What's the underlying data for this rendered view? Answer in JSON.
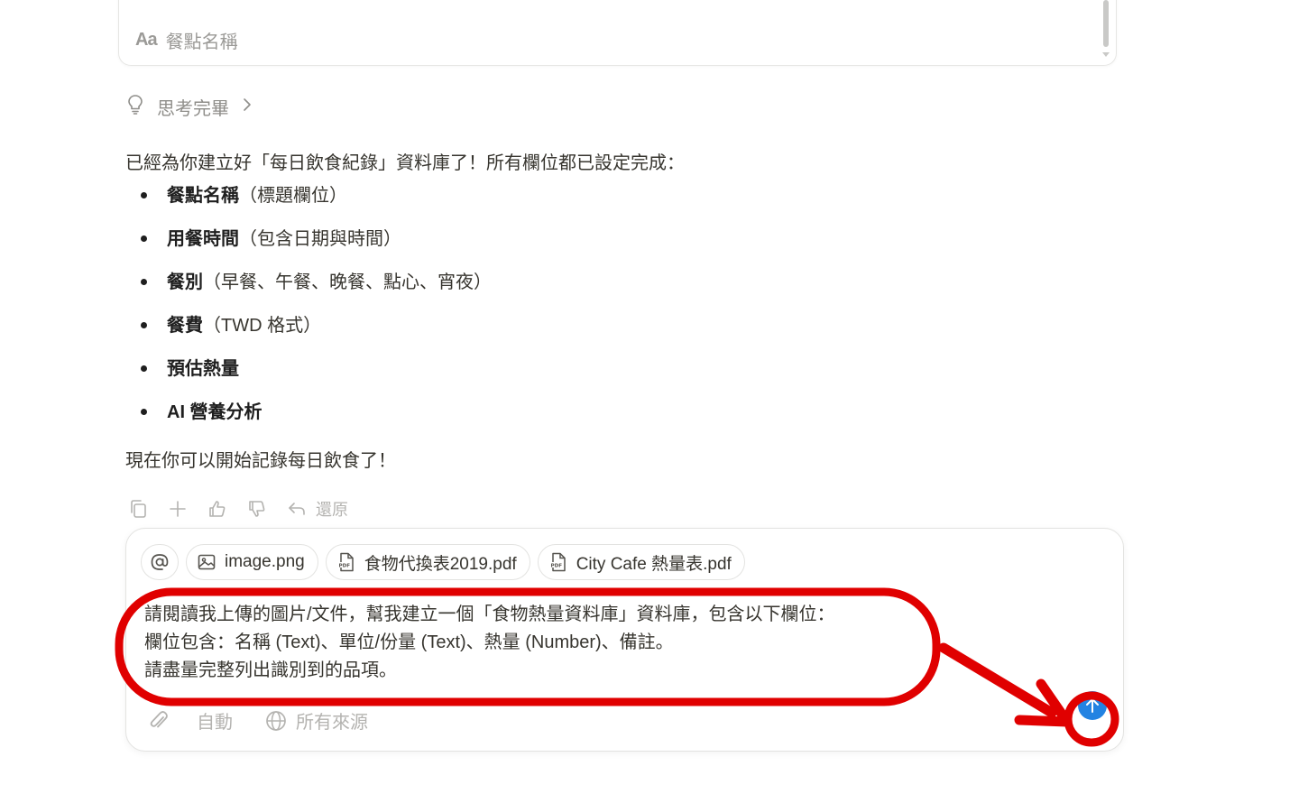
{
  "property_card": {
    "icon": "text-property-icon",
    "label": "餐點名稱"
  },
  "thinking": {
    "icon": "lightbulb-icon",
    "label": "思考完畢"
  },
  "reply": {
    "intro": "已經為你建立好「每日飲食紀錄」資料庫了！所有欄位都已設定完成：",
    "items": [
      {
        "bold": "餐點名稱",
        "rest": "（標題欄位）"
      },
      {
        "bold": "用餐時間",
        "rest": "（包含日期與時間）"
      },
      {
        "bold": "餐別",
        "rest": "（早餐、午餐、晚餐、點心、宵夜）"
      },
      {
        "bold": "餐費",
        "rest": "（TWD 格式）"
      },
      {
        "bold": "預估熱量",
        "rest": ""
      },
      {
        "bold": "AI 營養分析",
        "rest": ""
      }
    ],
    "outro": "現在你可以開始記錄每日飲食了！"
  },
  "actions": {
    "undo_label": "還原"
  },
  "composer": {
    "attachments": [
      {
        "icon": "image-icon",
        "name": "image.png"
      },
      {
        "icon": "pdf-icon",
        "name": "食物代換表2019.pdf"
      },
      {
        "icon": "pdf-icon",
        "name": "City Cafe 熱量表.pdf"
      }
    ],
    "prompt_lines": [
      "請閱讀我上傳的圖片/文件，幫我建立一個「食物熱量資料庫」資料庫，包含以下欄位：",
      "欄位包含：名稱 (Text)、單位/份量 (Text)、熱量 (Number)、備註。",
      "請盡量完整列出識別到的品項。"
    ],
    "mode_label": "自動",
    "sources_label": "所有來源"
  },
  "colors": {
    "accent": "#2383e2",
    "annotation": "#e00000"
  }
}
